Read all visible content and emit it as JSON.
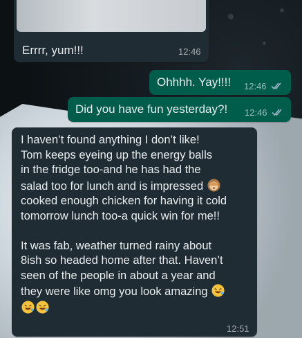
{
  "chat": {
    "incoming_photo_caption": "Errrr, yum!!!",
    "incoming_photo_time": "12:46",
    "out_msg1": {
      "text": "Ohhhh. Yay!!!!",
      "time": "12:46"
    },
    "out_msg2": {
      "text": "Did you have fun yesterday?!",
      "time": "12:46"
    },
    "long_msg": {
      "lines": [
        "I haven’t found anything I don’t like!",
        "Tom keeps eyeing up the energy balls",
        "in the fridge too-and he has had the",
        "salad too for lunch and is impressed",
        "cooked enough chicken for having it cold",
        "tomorrow lunch too-a quick win for me!!",
        "It was fab, weather turned rainy about",
        "8ish so headed home after that. Haven’t",
        "seen of the people in about a year and",
        "they were like omg you look amazing"
      ],
      "time": "12:51"
    }
  },
  "icons": {
    "read_ticks": "double-check-icon",
    "see_no_evil": "see-no-evil-monkey-emoji",
    "laughing": "rolling-on-floor-laughing-emoji"
  },
  "colors": {
    "incoming_bubble": "#1f2c33",
    "outgoing_bubble": "#005c4b",
    "read_tick": "#9fb8c9"
  }
}
